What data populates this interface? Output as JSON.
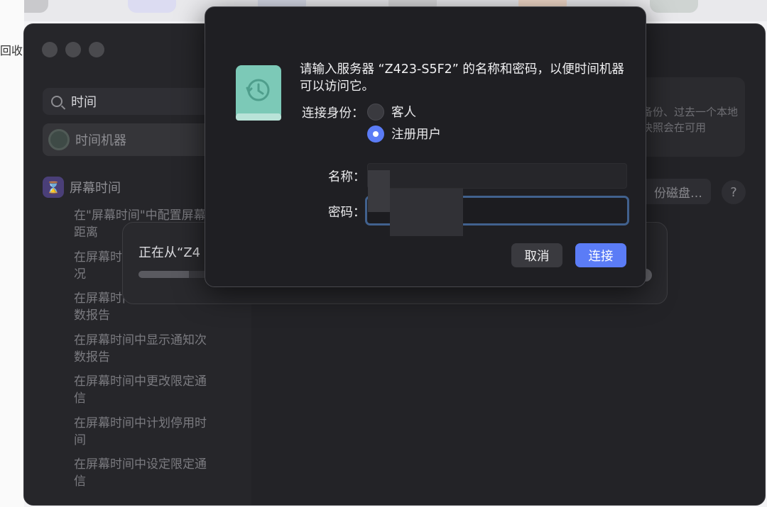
{
  "background": {
    "left_text": "回收",
    "bottom_text": "…"
  },
  "settings_window": {
    "search": {
      "value": "时间"
    },
    "sidebar": {
      "time_machine": "时间机器",
      "screen_time": "屏幕时间",
      "sub_items": [
        "在\"屏幕时间\"中配置屏幕距离",
        "在屏幕时间中查看使用情况",
        "在屏幕时间中查看使用次数报告",
        "在屏幕时间中显示通知次数报告",
        "在屏幕时间中更改限定通信",
        "在屏幕时间中计划停用时间",
        "在屏幕时间中设定限定通信"
      ]
    },
    "right_card_text": "备份、过去一个本地快照会在可用",
    "disk_button": "份磁盘…",
    "help_button": "?"
  },
  "progress_sheet": {
    "label": "正在从“Z4",
    "progress": 0.1
  },
  "login_dialog": {
    "prompt": "请输入服务器 “Z423-S5F2” 的名称和密码，以便时间机器可以访问它。",
    "connect_as_label": "连接身份：",
    "options": {
      "guest": "客人",
      "registered": "注册用户"
    },
    "selected_option": "注册用户",
    "name_label": "名称：",
    "password_label": "密码：",
    "cancel": "取消",
    "connect": "连接",
    "colors": {
      "accent": "#5b7cf6",
      "focus_ring": "#41618e",
      "drive_icon": "#7cc9b7"
    }
  }
}
